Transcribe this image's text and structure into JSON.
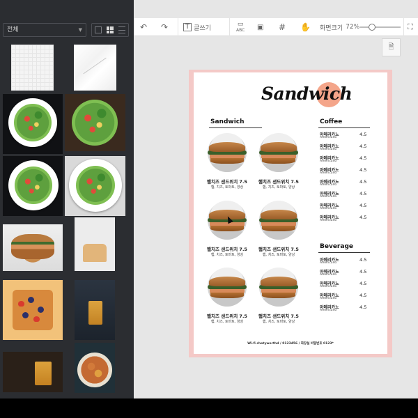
{
  "sidebar": {
    "category": "전체",
    "view_modes": [
      "single-view",
      "grid-view",
      "list-view"
    ]
  },
  "toolbar": {
    "undo_icon": "undo-icon",
    "redo_icon": "redo-icon",
    "text_label": "글쓰기",
    "abc_label": "ABC",
    "zoom_label": "화면크기",
    "zoom_value": "72%",
    "zoom_fraction": 0.3
  },
  "menu": {
    "logo": "Sandwich",
    "sandwich_section": "Sandwich",
    "coffee_section": "Coffee",
    "beverage_section": "Beverage",
    "sandwiches": [
      {
        "name": "햄치즈 샌드위치 7.5",
        "desc": "햄, 치즈, 토마토, 양상"
      },
      {
        "name": "햄치즈 샌드위치 7.5",
        "desc": "햄, 치즈, 토마토, 양상"
      },
      {
        "name": "햄치즈 샌드위치 7.5",
        "desc": "햄, 치즈, 토마토, 양상"
      },
      {
        "name": "햄치즈 샌드위치 7.5",
        "desc": "햄, 치즈, 토마토, 양상"
      },
      {
        "name": "햄치즈 샌드위치 7.5",
        "desc": "햄, 치즈, 토마토, 양상"
      },
      {
        "name": "햄치즈 샌드위치 7.5",
        "desc": "햄, 치즈, 토마토, 양상"
      }
    ],
    "coffee": [
      {
        "name": "아메리카노",
        "sub": "Americano",
        "price": "4.5"
      },
      {
        "name": "아메리카노",
        "sub": "Americano",
        "price": "4.5"
      },
      {
        "name": "아메리카노",
        "sub": "Americano",
        "price": "4.5"
      },
      {
        "name": "아메리카노",
        "sub": "Americano",
        "price": "4.5"
      },
      {
        "name": "아메리카노",
        "sub": "Americano",
        "price": "4.5"
      },
      {
        "name": "아메리카노",
        "sub": "Americano",
        "price": "4.5"
      },
      {
        "name": "아메리카노",
        "sub": "Americano",
        "price": "4.5"
      },
      {
        "name": "아메리카노",
        "sub": "Americano",
        "price": "4.5"
      }
    ],
    "beverage": [
      {
        "name": "아메리카노",
        "sub": "Americano",
        "price": "4.5"
      },
      {
        "name": "아메리카노",
        "sub": "Americano",
        "price": "4.5"
      },
      {
        "name": "아메리카노",
        "sub": "Americano",
        "price": "4.5"
      },
      {
        "name": "아메리카노",
        "sub": "Americano",
        "price": "4.5"
      },
      {
        "name": "아메리카노",
        "sub": "Americano",
        "price": "4.5"
      }
    ],
    "footer": "Wi-fi chotyworthd / 0123456 / 화장실 비밀번호 0123*"
  },
  "colors": {
    "sidebar_bg": "#2b2d31",
    "canvas_bg": "#e6e6e6",
    "page_border": "#f4c9c7",
    "logo_accent": "#f4a58a"
  }
}
